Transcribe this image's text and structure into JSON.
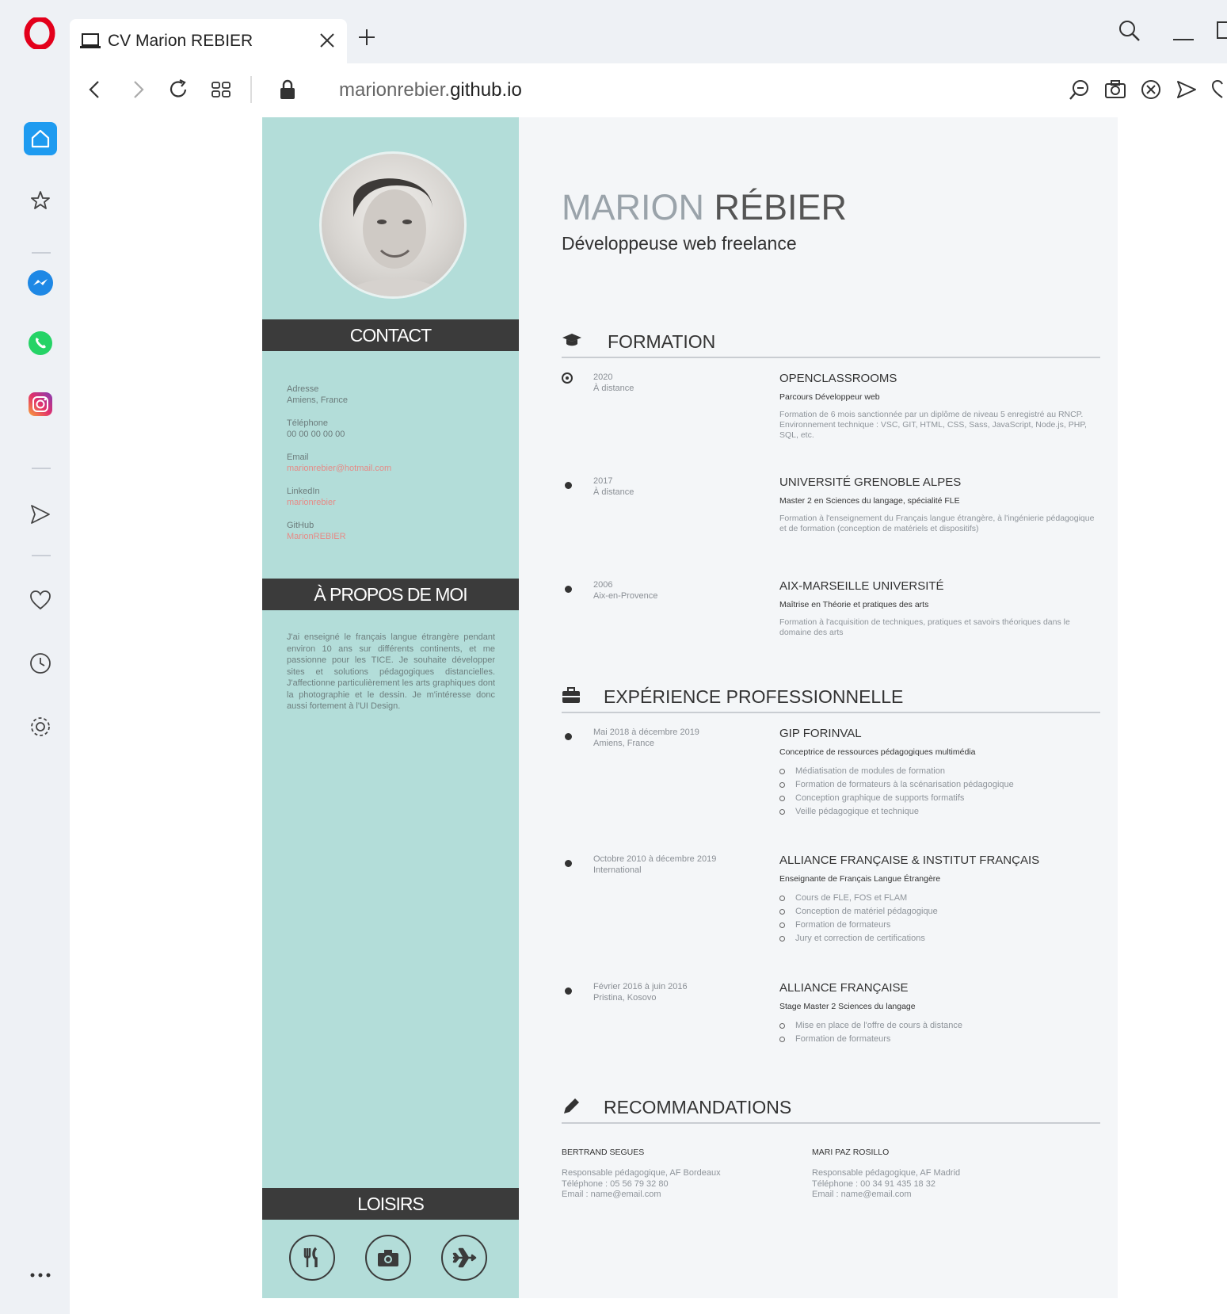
{
  "browser": {
    "tab_title": "CV Marion REBIER",
    "url_prefix": "marionrebier.",
    "url_domain": "github.io"
  },
  "cv": {
    "name_first": "MARION",
    "name_last": "RÉBIER",
    "job_title": "Développeuse web freelance",
    "contact_heading": "CONTACT",
    "contact": [
      {
        "label": "Adresse",
        "value": "Amiens, France"
      },
      {
        "label": "Téléphone",
        "value": "00 00 00 00 00"
      },
      {
        "label": "Email",
        "value": "marionrebier@hotmail.com"
      },
      {
        "label": "LinkedIn",
        "value": "marionrebier"
      },
      {
        "label": "GitHub",
        "value": "MarionREBIER"
      }
    ],
    "about_heading": "À PROPOS DE MOI",
    "about_text": "J'ai enseigné le français langue étrangère pendant environ 10 ans sur différents continents, et me passionne pour les TICE. Je souhaite développer sites et solutions pédagogiques distancielles. J'affectionne particulièrement les arts graphiques dont la photographie et le dessin. Je m'intéresse donc aussi fortement à l'UI Design.",
    "hobbies_heading": "LOISIRS",
    "formation_heading": "FORMATION",
    "formation": [
      {
        "year": "2020",
        "place": "À distance",
        "school": "OPENCLASSROOMS",
        "degree": "Parcours Développeur web",
        "desc": "Formation de 6 mois sanctionnée par un diplôme de niveau 5 enregistré au RNCP. Environnement technique : VSC, GIT, HTML, CSS, Sass, JavaScript, Node.js, PHP, SQL, etc."
      },
      {
        "year": "2017",
        "place": "À distance",
        "school": "UNIVERSITÉ GRENOBLE ALPES",
        "degree": "Master 2 en Sciences du langage, spécialité FLE",
        "desc": "Formation à l'enseignement du Français langue étrangère, à l'ingénierie pédagogique et de formation (conception de matériels et dispositifs)"
      },
      {
        "year": "2006",
        "place": "Aix-en-Provence",
        "school": "AIX-MARSEILLE UNIVERSITÉ",
        "degree": "Maîtrise en Théorie et pratiques des arts",
        "desc": "Formation à l'acquisition de techniques, pratiques et savoirs théoriques dans le domaine des arts"
      }
    ],
    "experience_heading": "EXPÉRIENCE PROFESSIONNELLE",
    "experience": [
      {
        "date": "Mai 2018 à décembre 2019",
        "place": "Amiens, France",
        "company": "GIP FORINVAL",
        "role": "Conceptrice de ressources pédagogiques multimédia",
        "tasks": [
          "Médiatisation de modules de formation",
          "Formation de formateurs à la scénarisation pédagogique",
          "Conception graphique de supports formatifs",
          "Veille pédagogique et technique"
        ]
      },
      {
        "date": "Octobre 2010 à décembre 2019",
        "place": "International",
        "company": "ALLIANCE FRANÇAISE & INSTITUT FRANÇAIS",
        "role": "Enseignante de Français Langue Étrangère",
        "tasks": [
          "Cours de FLE, FOS et FLAM",
          "Conception de matériel pédagogique",
          "Formation de formateurs",
          "Jury et correction de certifications"
        ]
      },
      {
        "date": "Février 2016 à juin 2016",
        "place": "Pristina, Kosovo",
        "company": "ALLIANCE FRANÇAISE",
        "role": "Stage Master 2 Sciences du langage",
        "tasks": [
          "Mise en place de l'offre de cours à distance",
          "Formation de formateurs"
        ]
      }
    ],
    "reco_heading": "RECOMMANDATIONS",
    "recommendations": [
      {
        "name": "BERTRAND SEGUES",
        "role": "Responsable pédagogique, AF Bordeaux",
        "phone": "Téléphone : 05 56 79 32 80",
        "email": "Email : name@email.com"
      },
      {
        "name": "MARI PAZ ROSILLO",
        "role": "Responsable pédagogique, AF Madrid",
        "phone": "Téléphone : 00 34 91 435 18 32",
        "email": "Email : name@email.com"
      }
    ]
  },
  "colors": {
    "sidebar_teal": "#b3ddd9",
    "dark_bar": "#3b3b3b",
    "link_coral": "#e68a86",
    "opera_red": "#e3001b",
    "opera_home_blue": "#1e9bf0"
  },
  "icons": [
    "opera-logo",
    "laptop-icon",
    "close-icon",
    "plus-icon",
    "search-icon",
    "minimize-icon",
    "back-icon",
    "forward-icon",
    "reload-icon",
    "speed-dial-icon",
    "lock-icon",
    "zoom-out-icon",
    "camera-icon",
    "block-icon",
    "send-icon",
    "heart-icon",
    "home-icon",
    "star-icon",
    "messenger-icon",
    "whatsapp-icon",
    "instagram-icon",
    "clock-icon",
    "settings-icon",
    "more-icon",
    "graduation-cap-icon",
    "briefcase-icon",
    "pencil-icon",
    "cutlery-icon",
    "plane-icon"
  ]
}
